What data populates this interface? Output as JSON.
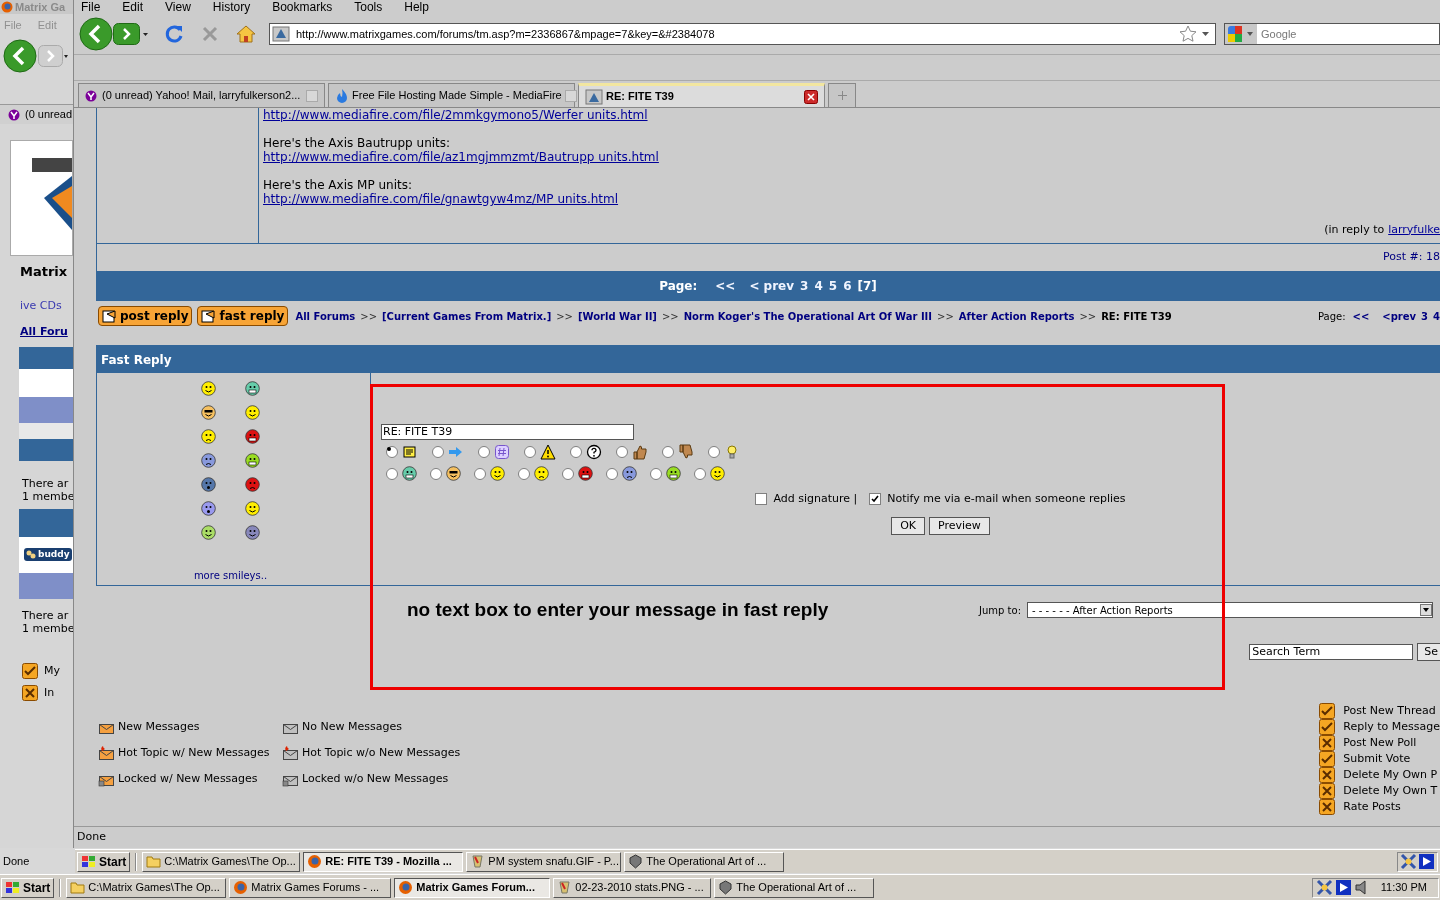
{
  "back_window": {
    "title": "Matrix Ga",
    "menu": [
      "File",
      "Edit"
    ],
    "tab": "(0 unread",
    "site_title": "Matrix",
    "nav_links": [
      "ive CDs",
      "All Foru"
    ],
    "online_1": [
      "There ar",
      "1 membe"
    ],
    "buddy": "buddy",
    "online_2": [
      "There ar",
      "1 membe"
    ],
    "permissions": [
      {
        "label": "My",
        "allowed": true
      },
      {
        "label": "In",
        "allowed": false
      }
    ],
    "status": "Done"
  },
  "menu": [
    "File",
    "Edit",
    "View",
    "History",
    "Bookmarks",
    "Tools",
    "Help"
  ],
  "address": "http://www.matrixgames.com/forums/tm.asp?m=2336867&mpage=7&key=&#2384078",
  "search_placeholder": "Google",
  "tabs": [
    {
      "label": "(0 unread) Yahoo! Mail, larryfulkerson2...",
      "selected": false
    },
    {
      "label": "Free File Hosting Made Simple - MediaFire",
      "selected": false
    },
    {
      "label": "RE: FITE T39",
      "selected": true
    }
  ],
  "post": {
    "blocks": [
      {
        "link": "http://www.mediafire.com/file/2mmkgymono5/Werfer units.html"
      },
      {
        "caption": "Here's the Axis Bautrupp units:",
        "link": "http://www.mediafire.com/file/az1mgjmmzmt/Bautrupp units.html"
      },
      {
        "caption": "Here's the Axis MP units:",
        "link": "http://www.mediafire.com/file/gnawtgyw4mz/MP units.html"
      }
    ],
    "reply_to_label": "(in reply to",
    "reply_to": "larryfulke",
    "post_number": "Post #: 18"
  },
  "pager": {
    "label": "Page:",
    "first": "<<",
    "prev": "< prev",
    "pages": [
      {
        "text": "3",
        "selected": false
      },
      {
        "text": "4",
        "selected": false
      },
      {
        "text": "5",
        "selected": false
      },
      {
        "text": "6",
        "selected": false
      },
      {
        "text": "[7]",
        "selected": true
      }
    ]
  },
  "buttons": [
    "post reply",
    "fast reply"
  ],
  "breadcrumb": [
    {
      "kind": "link",
      "text": "All Forums"
    },
    {
      "kind": "sep",
      "text": ">>"
    },
    {
      "kind": "link",
      "text": "[Current Games From Matrix.]"
    },
    {
      "kind": "sep",
      "text": ">>"
    },
    {
      "kind": "link",
      "text": "[World War II]"
    },
    {
      "kind": "sep",
      "text": ">>"
    },
    {
      "kind": "link",
      "text": "Norm Koger's The Operational Art Of War III"
    },
    {
      "kind": "sep",
      "text": ">>"
    },
    {
      "kind": "link",
      "text": "After Action Reports"
    },
    {
      "kind": "sep",
      "text": ">>"
    },
    {
      "kind": "current",
      "text": "RE: FITE T39"
    }
  ],
  "pager_small": {
    "label": "Page:",
    "first": "<<",
    "prev": "<prev",
    "pages": [
      {
        "text": "3",
        "selected": false
      },
      {
        "text": "4",
        "selected": false
      }
    ]
  },
  "fast_reply": {
    "title": "Fast Reply",
    "more_smileys": "more smileys..",
    "subject": "RE: FITE T39",
    "post_icons": [
      {
        "selected": true
      },
      {
        "selected": false
      },
      {
        "selected": false
      },
      {
        "selected": false
      },
      {
        "selected": false
      },
      {
        "selected": false
      },
      {
        "selected": false
      },
      {
        "selected": false
      }
    ],
    "smiley_options": [
      {
        "selected": false
      },
      {
        "selected": false
      },
      {
        "selected": false
      },
      {
        "selected": false
      },
      {
        "selected": false
      },
      {
        "selected": false
      },
      {
        "selected": false
      },
      {
        "selected": false
      }
    ],
    "add_signature": {
      "label": "Add signature |",
      "checked": false
    },
    "notify": {
      "label": "Notify me via e-mail when someone replies",
      "checked": true
    },
    "actions": [
      "OK",
      "Preview"
    ]
  },
  "annotation": "no text box to enter your message in fast reply",
  "jump_to": {
    "label": "Jump to:",
    "value": "- - - - - - After Action Reports"
  },
  "search": {
    "value": "Search Term",
    "button": "Se"
  },
  "legend": [
    "New Messages",
    "No New Messages",
    "Hot Topic w/ New Messages",
    "Hot Topic w/o New Messages",
    "Locked w/ New Messages",
    "Locked w/o New Messages"
  ],
  "permissions": [
    {
      "label": "Post New Thread",
      "allowed": true
    },
    {
      "label": "Reply to Message",
      "allowed": true
    },
    {
      "label": "Post New Poll",
      "allowed": false
    },
    {
      "label": "Submit Vote",
      "allowed": true
    },
    {
      "label": "Delete My Own P",
      "allowed": false
    },
    {
      "label": "Delete My Own T",
      "allowed": false
    },
    {
      "label": "Rate Posts",
      "allowed": false
    }
  ],
  "status": "Done",
  "inner_taskbar": {
    "start": "Start",
    "tasks": [
      {
        "label": "C:\\Matrix Games\\The Op...",
        "selected": false
      },
      {
        "label": "RE: FITE T39 - Mozilla ...",
        "selected": true
      },
      {
        "label": "PM system snafu.GIF - P...",
        "selected": false
      },
      {
        "label": "The Operational Art of ...",
        "selected": false
      }
    ]
  },
  "taskbar": {
    "start": "Start",
    "tasks": [
      {
        "label": "C:\\Matrix Games\\The Op...",
        "selected": false
      },
      {
        "label": "Matrix Games Forums - ...",
        "selected": false
      },
      {
        "label": "Matrix Games Forum...",
        "selected": true
      },
      {
        "label": "02-23-2010 stats.PNG - ...",
        "selected": false
      },
      {
        "label": "The Operational Art of ...",
        "selected": false
      }
    ],
    "clock": "11:30 PM"
  }
}
